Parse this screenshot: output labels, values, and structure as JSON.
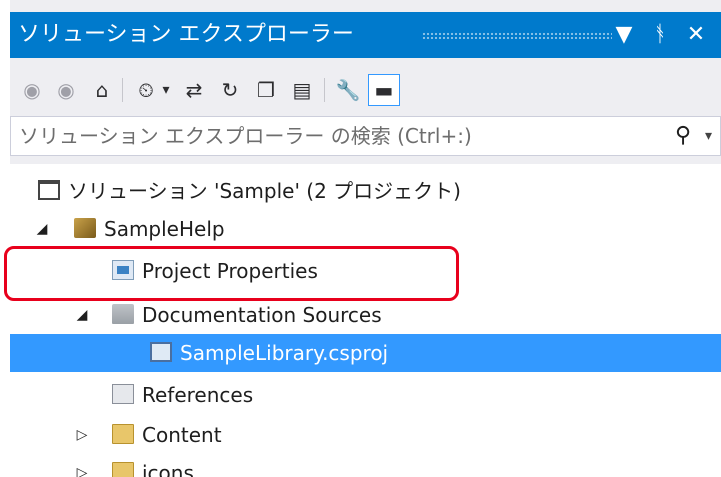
{
  "window": {
    "title": "ソリューション エクスプローラー",
    "buttons": [
      "▼",
      "ᚬ",
      "✕"
    ]
  },
  "toolbar": {
    "icons": [
      "back-icon",
      "forward-icon",
      "home-icon",
      "pending-changes-icon",
      "sync-icon",
      "refresh-icon",
      "collapse-all-icon",
      "show-all-files-icon",
      "properties-icon",
      "preview-icon"
    ]
  },
  "search": {
    "placeholder": "ソリューション エクスプローラー の検索 (Ctrl+:)"
  },
  "tree": {
    "items": [
      {
        "label": "ソリューション 'Sample' (2 プロジェクト)",
        "arrow": ""
      },
      {
        "label": "SampleHelp",
        "arrow": "◢"
      },
      {
        "label": "Project Properties",
        "arrow": ""
      },
      {
        "label": "Documentation Sources",
        "arrow": "◢"
      },
      {
        "label": "SampleLibrary.csproj",
        "arrow": ""
      },
      {
        "label": "References",
        "arrow": ""
      },
      {
        "label": "Content",
        "arrow": "▷"
      },
      {
        "label": "icons",
        "arrow": "▷"
      }
    ]
  },
  "colors": {
    "accent": "#007acc",
    "selection": "#3399ff",
    "highlight": "#e8001c"
  }
}
